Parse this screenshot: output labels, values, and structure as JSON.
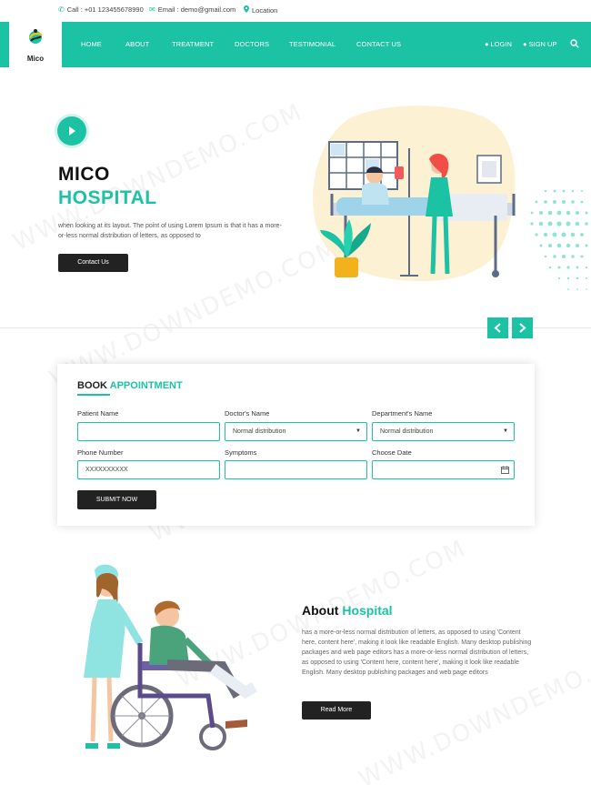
{
  "topbar": {
    "call": "Call : +01 123455678990",
    "email": "Email : demo@gmail.com",
    "location": "Location"
  },
  "brand": {
    "name": "Mico"
  },
  "nav": {
    "items": [
      "HOME",
      "ABOUT",
      "TREATMENT",
      "DOCTORS",
      "TESTIMONIAL",
      "CONTACT US"
    ],
    "login": "LOGIN",
    "signup": "SIGN UP"
  },
  "hero": {
    "title_line1": "MICO",
    "title_line2": "HOSPITAL",
    "text": "when looking at its layout. The point of using Lorem Ipsum is that it has a more-or-less normal distribution of letters, as opposed to",
    "button": "Contact Us"
  },
  "appointment": {
    "title_a": "BOOK",
    "title_b": "APPOINTMENT",
    "labels": {
      "patient_name": "Patient Name",
      "doctors_name": "Doctor's Name",
      "department_name": "Department's Name",
      "phone_number": "Phone Number",
      "symptoms": "Symptoms",
      "choose_date": "Choose Date"
    },
    "values": {
      "patient_name": "",
      "doctors_name": "Normal distribution",
      "department_name": "Normal distribution",
      "phone_number": "XXXXXXXXXX",
      "symptoms": "",
      "choose_date": ""
    },
    "submit": "SUBMIT NOW"
  },
  "about": {
    "title_a": "About",
    "title_b": "Hospital",
    "text": "has a more-or-less normal distribution of letters, as opposed to using 'Content here, content here', making it look like readable English. Many desktop publishing packages and web page editors has a more-or-less normal distribution of letters, as opposed to using 'Content here, content here', making it look like readable English. Many desktop publishing packages and web page editors",
    "button": "Read More"
  },
  "watermark": "WWW.DOWNDEMO.COM",
  "colors": {
    "accent": "#1bc2a3",
    "dark": "#222222"
  }
}
